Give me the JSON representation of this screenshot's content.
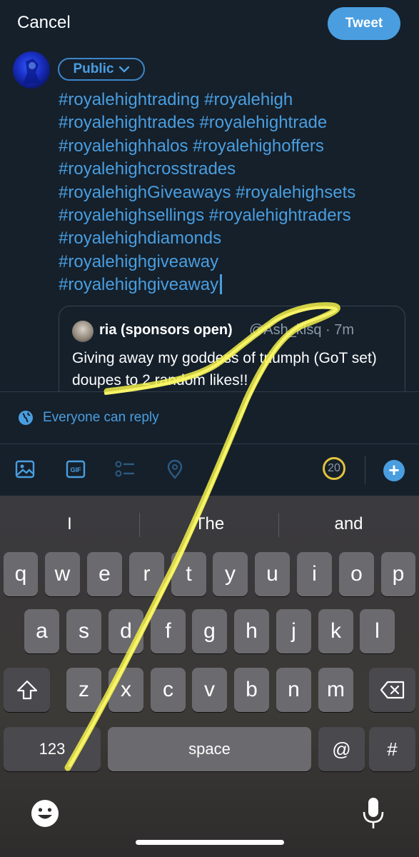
{
  "header": {
    "cancel_label": "Cancel",
    "tweet_label": "Tweet"
  },
  "composer": {
    "audience_label": "Public",
    "hashtag_lines": [
      "#royalehightrading #royalehigh",
      "#royalehightrades #royalehightrade",
      "#royalehighhalos #royalehighoffers",
      "#royalehighcrosstrades",
      "#royalehighGiveaways #royalehighsets",
      "#royalehighsellings #royalehightraders",
      "#royalehighdiamonds",
      "#royalehighgiveaway",
      "#royalehighgiveaway"
    ]
  },
  "quoted_tweet": {
    "name": "ria (sponsors open)",
    "handle_time": "@Ash_klsq · 7m",
    "text": "Giving away my goddess of triumph (GoT set) doupes to 2 random likes!!"
  },
  "reply_setting": {
    "label": "Everyone can reply"
  },
  "toolbar": {
    "icons": [
      "image-icon",
      "gif-icon",
      "poll-icon",
      "location-icon"
    ],
    "character_counter": "20",
    "counter_color": "#e3c33a"
  },
  "keyboard": {
    "suggestions": [
      "I",
      "The",
      "and"
    ],
    "row1": [
      "q",
      "w",
      "e",
      "r",
      "t",
      "y",
      "u",
      "i",
      "o",
      "p"
    ],
    "row2": [
      "a",
      "s",
      "d",
      "f",
      "g",
      "h",
      "j",
      "k",
      "l"
    ],
    "row3": [
      "z",
      "x",
      "c",
      "v",
      "b",
      "n",
      "m"
    ],
    "numbers_key": "123",
    "space_key": "space",
    "at_key": "@",
    "hash_key": "#"
  },
  "colors": {
    "accent": "#4a9ee0",
    "background": "#15202b",
    "highlighter": "#f2f04a"
  }
}
